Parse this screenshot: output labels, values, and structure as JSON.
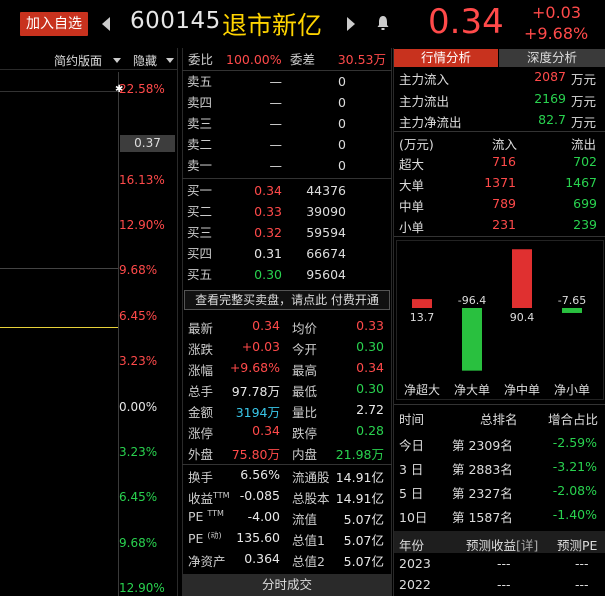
{
  "header": {
    "add_button": "加入自选",
    "code": "600145",
    "name": "退市新亿",
    "price": "0.34",
    "change": "+0.03",
    "change_pct": "+9.68%"
  },
  "chart_toolbar": {
    "mode": "简约版面",
    "hide": "隐藏"
  },
  "chart_ticks": [
    {
      "label": "22.58%",
      "color": "#ff4a4a"
    },
    {
      "label": "16.13%",
      "color": "#ff4a4a"
    },
    {
      "label": "12.90%",
      "color": "#ff4a4a"
    },
    {
      "label": "9.68%",
      "color": "#ff4a4a"
    },
    {
      "label": "6.45%",
      "color": "#ff4a4a"
    },
    {
      "label": "3.23%",
      "color": "#ff4a4a"
    },
    {
      "label": "0.00%",
      "color": "#e8e8e8"
    },
    {
      "label": "3.23%",
      "color": "#29d24f"
    },
    {
      "label": "6.45%",
      "color": "#29d24f"
    },
    {
      "label": "9.68%",
      "color": "#29d24f"
    },
    {
      "label": "12.90%",
      "color": "#29d24f"
    }
  ],
  "chart_price_box": "0.37",
  "ratio": {
    "weibi_label": "委比",
    "weibi_value": "100.00%",
    "weicha_label": "委差",
    "weicha_value": "30.53万"
  },
  "sell_orders": [
    {
      "label": "卖五",
      "price": "—",
      "vol": "0"
    },
    {
      "label": "卖四",
      "price": "—",
      "vol": "0"
    },
    {
      "label": "卖三",
      "price": "—",
      "vol": "0"
    },
    {
      "label": "卖二",
      "price": "—",
      "vol": "0"
    },
    {
      "label": "卖一",
      "price": "—",
      "vol": "0"
    }
  ],
  "buy_orders": [
    {
      "label": "买一",
      "price": "0.34",
      "vol": "44376",
      "color": "#ff4a4a"
    },
    {
      "label": "买二",
      "price": "0.33",
      "vol": "39090",
      "color": "#ff4a4a"
    },
    {
      "label": "买三",
      "price": "0.32",
      "vol": "59594",
      "color": "#ff4a4a"
    },
    {
      "label": "买四",
      "price": "0.31",
      "vol": "66674",
      "color": "#e8e8e8"
    },
    {
      "label": "买五",
      "price": "0.30",
      "vol": "95604",
      "color": "#29d24f"
    }
  ],
  "full_book_link": "查看完整买卖盘，请点此 付费开通",
  "quote": {
    "latest_label": "最新",
    "latest": "0.34",
    "avg_label": "均价",
    "avg": "0.33",
    "chg_label": "涨跌",
    "chg": "+0.03",
    "open_label": "今开",
    "open": "0.30",
    "pct_label": "涨幅",
    "pct": "+9.68%",
    "high_label": "最高",
    "high": "0.34",
    "vol_label": "总手",
    "vol": "97.78万",
    "low_label": "最低",
    "low": "0.30",
    "amount_label": "金额",
    "amount": "3194万",
    "vr_label": "量比",
    "vr": "2.72",
    "limit_up_label": "涨停",
    "limit_up": "0.34",
    "limit_down_label": "跌停",
    "limit_down": "0.28",
    "outer_label": "外盘",
    "outer": "75.80万",
    "inner_label": "内盘",
    "inner": "21.98万"
  },
  "fundamentals": {
    "turnover_label": "换手",
    "turnover": "6.56%",
    "float_shares_label": "流通股",
    "float_shares": "14.91亿",
    "eps_label": "收益",
    "eps_sup": "TTM",
    "eps": "-0.085",
    "total_shares_label": "总股本",
    "total_shares": "14.91亿",
    "pe_ttm_label": "PE",
    "pe_ttm_sup": "TTM",
    "pe_ttm": "-4.00",
    "float_value_label": "流值",
    "float_value": "5.07亿",
    "pe_dyn_label": "PE",
    "pe_dyn_sup": "(动)",
    "pe_dyn": "135.60",
    "total_value1_label": "总值1",
    "total_value1": "5.07亿",
    "nav_label": "净资产",
    "nav": "0.364",
    "total_value2_label": "总值2",
    "total_value2": "5.07亿"
  },
  "bottom_tab": "分时成交",
  "right_tabs": {
    "market_analysis": "行情分析",
    "deep_analysis": "深度分析"
  },
  "fund_flow": {
    "inflow_label": "主力流入",
    "inflow": "2087",
    "unit": "万元",
    "outflow_label": "主力流出",
    "outflow": "2169",
    "net_label": "主力净流出",
    "net": "82.7"
  },
  "flow_table": {
    "unit_header": "(万元)",
    "in_header": "流入",
    "out_header": "流出",
    "rows": [
      {
        "label": "超大",
        "in": "716",
        "out": "702"
      },
      {
        "label": "大单",
        "in": "1371",
        "out": "1467"
      },
      {
        "label": "中单",
        "in": "789",
        "out": "699"
      },
      {
        "label": "小单",
        "in": "231",
        "out": "239"
      }
    ]
  },
  "chart_data": {
    "type": "bar",
    "categories": [
      "净超大",
      "净大单",
      "净中单",
      "净小单"
    ],
    "values": [
      13.7,
      -96.4,
      90.4,
      -7.65
    ],
    "value_labels": [
      "13.7",
      "-96.4",
      "90.4",
      "-7.65"
    ],
    "colors": [
      "#e03030",
      "#29c03f",
      "#e03030",
      "#29c03f"
    ]
  },
  "ranking": {
    "time_header": "时间",
    "rank_header": "总排名",
    "ratio_header": "增合占比",
    "rows": [
      {
        "period": "今日",
        "rank": "第 2309名",
        "ratio": "-2.59%"
      },
      {
        "period": "3 日",
        "rank": "第 2883名",
        "ratio": "-3.21%"
      },
      {
        "period": "5 日",
        "rank": "第 2327名",
        "ratio": "-2.08%"
      },
      {
        "period": "10日",
        "rank": "第 1587名",
        "ratio": "-1.40%"
      }
    ]
  },
  "forecast": {
    "year_header": "年份",
    "eps_header": "预测收益",
    "detail": "[详]",
    "pe_header": "预测PE",
    "rows": [
      {
        "year": "2023",
        "eps": "---",
        "pe": "---"
      },
      {
        "year": "2022",
        "eps": "---",
        "pe": "---"
      }
    ]
  }
}
